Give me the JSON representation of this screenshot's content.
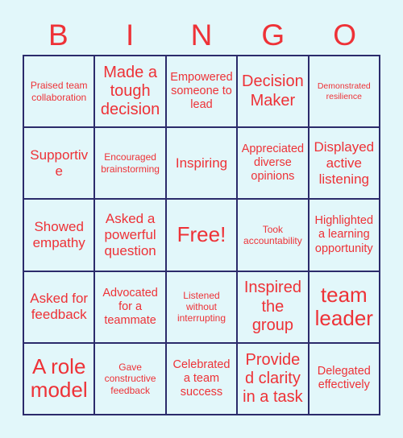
{
  "card": {
    "title": "BINGO",
    "header_letters": [
      "B",
      "I",
      "N",
      "G",
      "O"
    ],
    "colors": {
      "background": "#e2f7fa",
      "cell_fill": "#e2f7fa",
      "grid_line": "#2b2b6b",
      "text_red": "#ee3237"
    },
    "grid": {
      "columns": 5,
      "rows": 5,
      "free_space_index": 12,
      "free_space_label": "Free!"
    },
    "cells": [
      {
        "text": "Praised team collaboration",
        "size": "fs-sm"
      },
      {
        "text": "Made a tough decision",
        "size": "fs-xl"
      },
      {
        "text": "Empowered someone to lead",
        "size": "fs-md"
      },
      {
        "text": "Decision Maker",
        "size": "fs-xl"
      },
      {
        "text": "Demonstrated resilience",
        "size": "fs-xs"
      },
      {
        "text": "Supportive",
        "size": "fs-lg"
      },
      {
        "text": "Encouraged brainstorming",
        "size": "fs-sm"
      },
      {
        "text": "Inspiring",
        "size": "fs-lg"
      },
      {
        "text": "Appreciated diverse opinions",
        "size": "fs-md"
      },
      {
        "text": "Displayed active listening",
        "size": "fs-lg"
      },
      {
        "text": "Showed empathy",
        "size": "fs-lg"
      },
      {
        "text": "Asked a powerful question",
        "size": "fs-lg"
      },
      {
        "text": "Free!",
        "size": "fs-xxl"
      },
      {
        "text": "Took accountability",
        "size": "fs-sm"
      },
      {
        "text": "Highlighted a learning opportunity",
        "size": "fs-md"
      },
      {
        "text": "Asked for feedback",
        "size": "fs-lg"
      },
      {
        "text": "Advocated for a teammate",
        "size": "fs-md"
      },
      {
        "text": "Listened without interrupting",
        "size": "fs-sm"
      },
      {
        "text": "Inspired the group",
        "size": "fs-xl"
      },
      {
        "text": "team leader",
        "size": "fs-xxl"
      },
      {
        "text": "A role model",
        "size": "fs-xxl"
      },
      {
        "text": "Gave constructive feedback",
        "size": "fs-sm"
      },
      {
        "text": "Celebrated a team success",
        "size": "fs-md"
      },
      {
        "text": "Provided clarity in a task",
        "size": "fs-xl"
      },
      {
        "text": "Delegated effectively",
        "size": "fs-md"
      }
    ]
  }
}
